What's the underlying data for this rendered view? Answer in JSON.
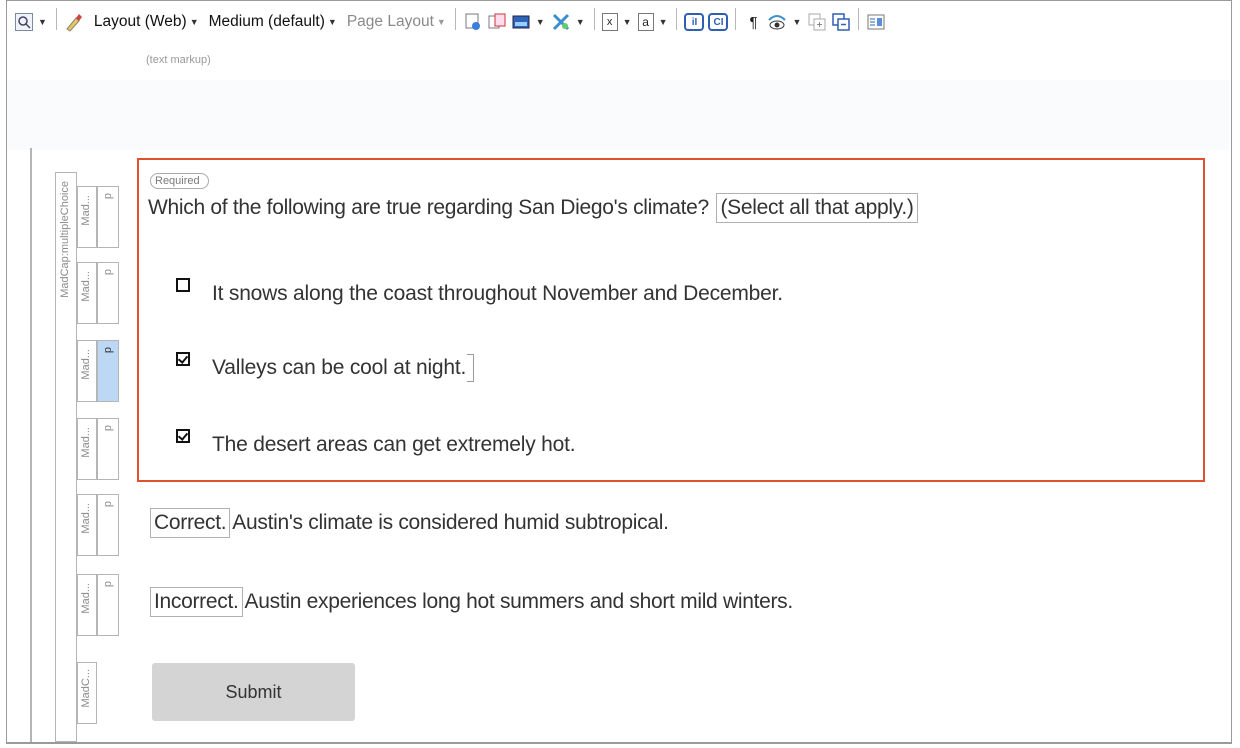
{
  "toolbar": {
    "layout_label": "Layout (Web)",
    "medium_label": "Medium (default)",
    "page_layout_label": "Page Layout"
  },
  "markup_label": "(text markup)",
  "structure": {
    "group_label": "MadCap:multipleChoice",
    "p_marker": "p",
    "row_labels": [
      "Mad...",
      "Mad...",
      "Mad...",
      "Mad...",
      "Mad...",
      "Mad...",
      "MadC..."
    ]
  },
  "question": {
    "required_tag": "Required",
    "text": "Which of the following are true regarding San Diego's climate?",
    "instruction": "(Select all that apply.)",
    "options": [
      {
        "text": "It snows along the coast throughout November and December.",
        "checked": false
      },
      {
        "text": "Valleys can be cool at night.",
        "checked": true
      },
      {
        "text": "The desert areas can get extremely hot.",
        "checked": true
      }
    ]
  },
  "feedback": {
    "correct_label": "Correct.",
    "correct_text": "Austin's climate is considered humid subtropical.",
    "incorrect_label": "Incorrect.",
    "incorrect_text": "Austin experiences long hot summers and short mild winters."
  },
  "submit_label": "Submit",
  "colors": {
    "highlight_border": "#e0522d",
    "selected_marker": "#bcd8f5"
  }
}
